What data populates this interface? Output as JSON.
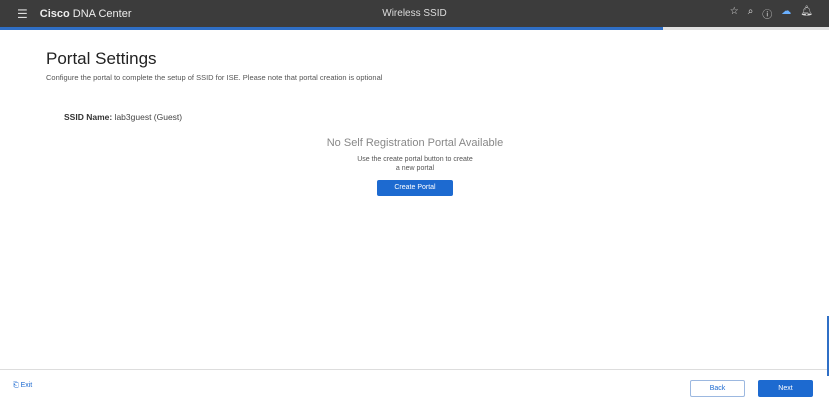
{
  "header": {
    "brand_bold": "Cisco",
    "brand_rest": "DNA Center",
    "title": "Wireless SSID",
    "icons": [
      "star-icon",
      "search-icon",
      "help-icon",
      "cloud-icon",
      "bell-icon"
    ]
  },
  "progress": {
    "percent": 80
  },
  "page": {
    "title": "Portal Settings",
    "subtitle": "Configure the portal to complete the setup of SSID for ISE. Please note that portal creation is optional",
    "ssid_label": "SSID Name:",
    "ssid_value": "lab3guest (Guest)"
  },
  "empty": {
    "title": "No Self Registration Portal Available",
    "desc": "Use the create portal button to create a new portal",
    "button": "Create Portal"
  },
  "footer": {
    "exit": "Exit",
    "back": "Back",
    "next": "Next"
  },
  "colors": {
    "accent": "#1d6ad0",
    "header": "#3c3c3c"
  }
}
